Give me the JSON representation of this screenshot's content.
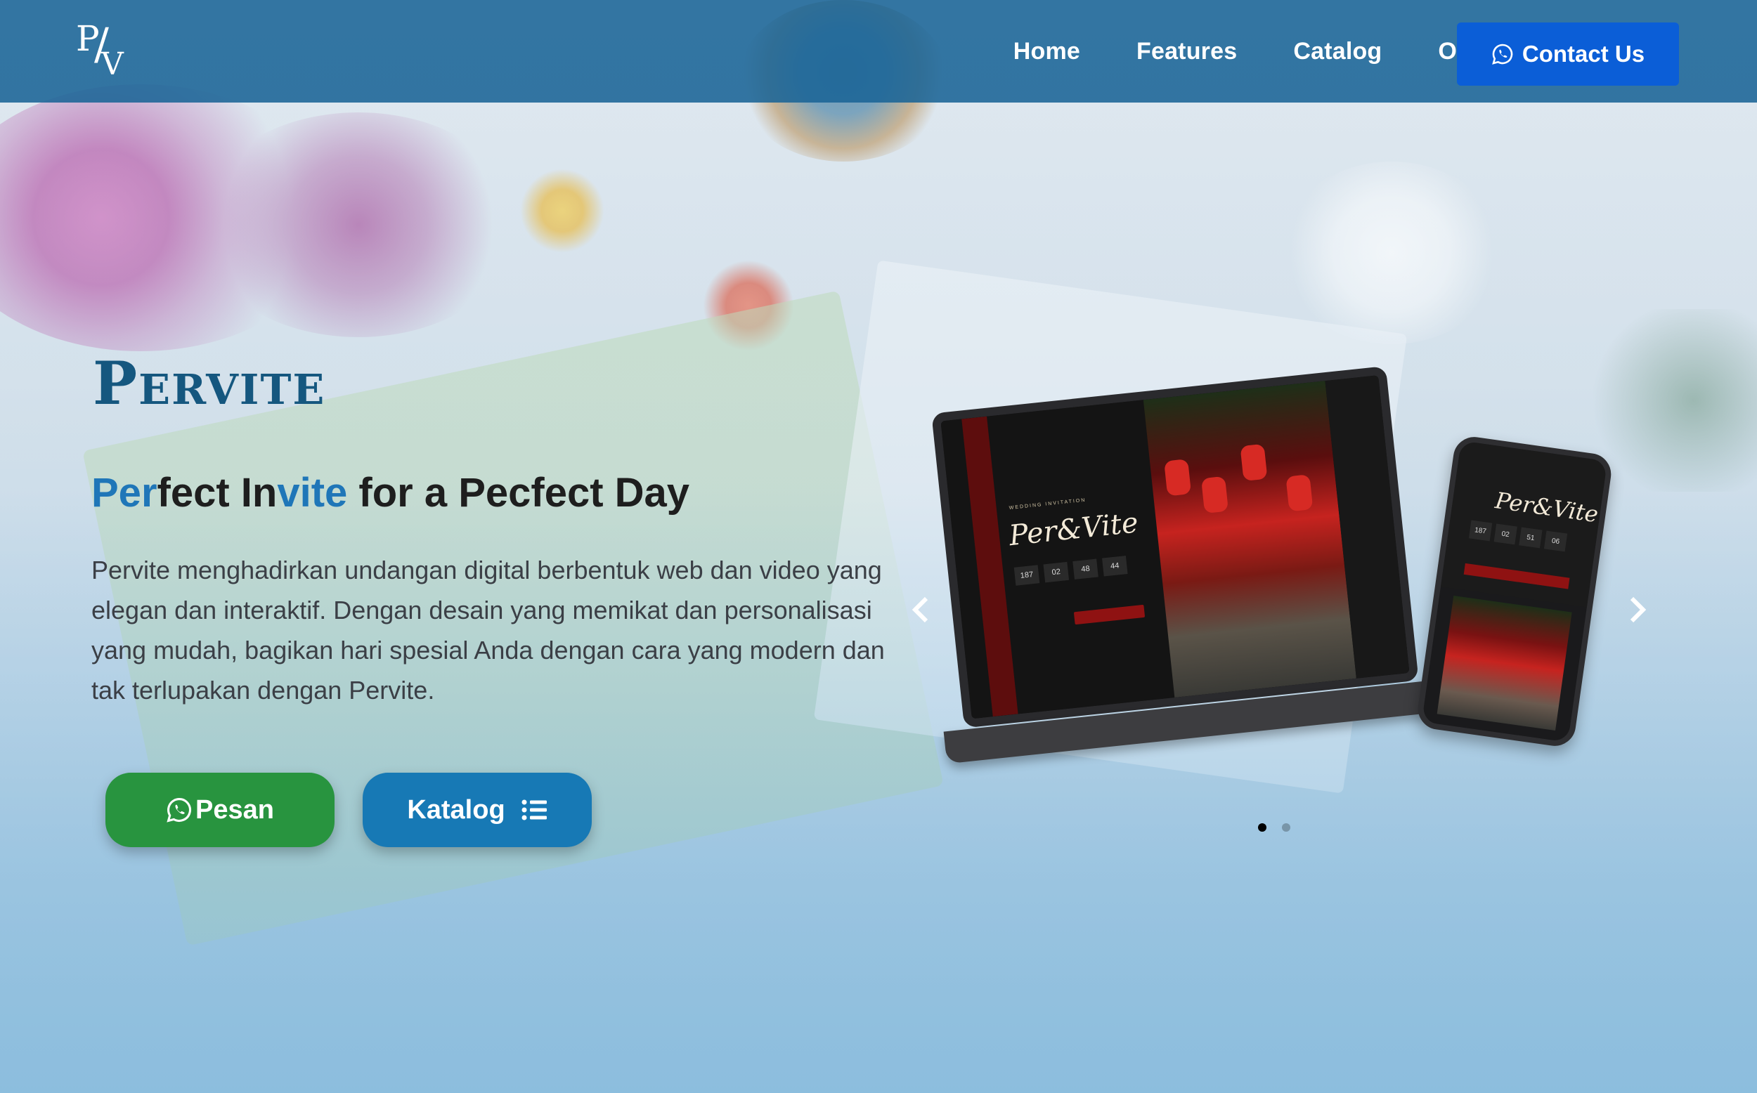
{
  "nav": {
    "logo_text": "P/V",
    "links": [
      "Home",
      "Features",
      "Catalog",
      "Order"
    ],
    "contact_label": "Contact Us"
  },
  "hero": {
    "brand": "Pervite",
    "tagline": {
      "part1": "Per",
      "part2": "fect In",
      "part3": "vite",
      "part4": " for a Pecfect Day"
    },
    "description": "Pervite menghadirkan undangan digital berbentuk web dan video yang elegan dan interaktif. Dengan desain yang memikat dan personalisasi yang mudah, bagikan hari spesial Anda dengan cara yang modern dan tak terlupakan dengan Pervite.",
    "order_button": "Pesan",
    "catalog_button": "Katalog"
  },
  "carousel": {
    "active_index": 0,
    "slide_count": 2,
    "mockup": {
      "label_small": "WEDDING INVITATION",
      "title": "Per&Vite",
      "laptop_counter": [
        "187",
        "02",
        "48",
        "44"
      ],
      "phone_counter": [
        "187",
        "02",
        "51",
        "06"
      ]
    }
  },
  "icons": {
    "whatsapp": "whatsapp-icon",
    "list": "list-icon",
    "prev": "chevron-left-icon",
    "next": "chevron-right-icon"
  },
  "colors": {
    "navbar": "#1a6496",
    "contact_button": "#0b5ed7",
    "brand": "#15577f",
    "tagline_highlight": "#1f76b8",
    "order_button": "#28943f",
    "catalog_button": "#1779b5"
  }
}
